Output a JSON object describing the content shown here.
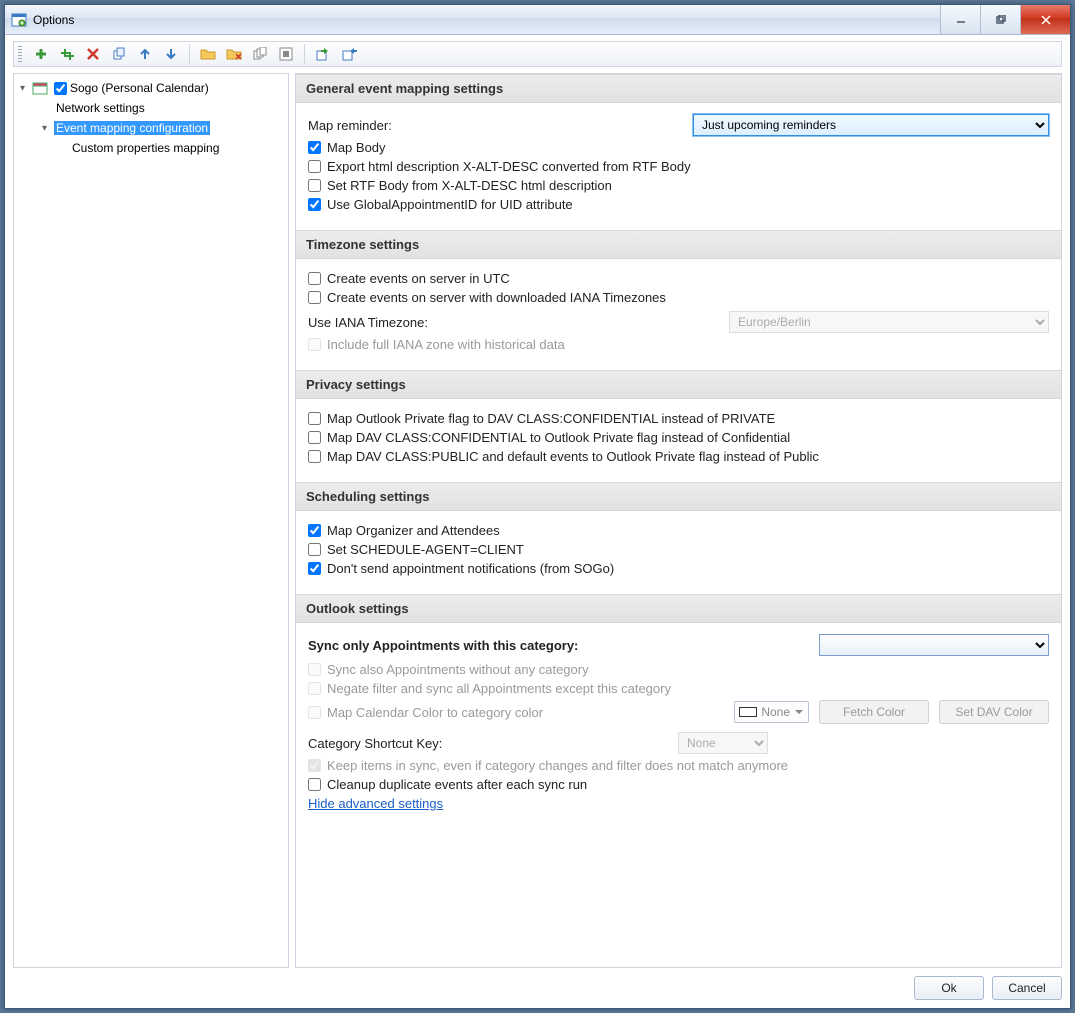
{
  "window": {
    "title": "Options"
  },
  "toolbar_icons": [
    "add",
    "add-multi",
    "delete",
    "copy",
    "up",
    "down",
    "folder",
    "folder-x",
    "copy-all",
    "select-all",
    "export",
    "import"
  ],
  "tree": {
    "root": {
      "label": "Sogo (Personal Calendar)",
      "checked": true
    },
    "children": [
      {
        "label": "Network settings"
      },
      {
        "label": "Event mapping configuration",
        "selected": true,
        "expanded": true
      },
      {
        "label": "Custom properties mapping"
      }
    ]
  },
  "sections": {
    "general": {
      "title": "General event mapping settings",
      "map_reminder_label": "Map reminder:",
      "map_reminder_value": "Just upcoming reminders",
      "chk_map_body": {
        "label": "Map Body",
        "checked": true
      },
      "chk_export_xalt": {
        "label": "Export html description X-ALT-DESC converted from RTF Body",
        "checked": false
      },
      "chk_set_rtf": {
        "label": "Set RTF Body from X-ALT-DESC html description",
        "checked": false
      },
      "chk_use_globalid": {
        "label": "Use GlobalAppointmentID for UID attribute",
        "checked": true
      }
    },
    "timezone": {
      "title": "Timezone settings",
      "chk_utc": {
        "label": "Create events on server in UTC",
        "checked": false
      },
      "chk_iana_dl": {
        "label": "Create events on server with downloaded IANA Timezones",
        "checked": false
      },
      "use_iana_label": "Use IANA Timezone:",
      "use_iana_value": "Europe/Berlin",
      "chk_full_iana": {
        "label": "Include full IANA zone with historical data",
        "checked": false
      }
    },
    "privacy": {
      "title": "Privacy settings",
      "chk_priv_conf": {
        "label": "Map Outlook Private flag to DAV CLASS:CONFIDENTIAL instead of PRIVATE",
        "checked": false
      },
      "chk_conf_priv": {
        "label": "Map DAV CLASS:CONFIDENTIAL to Outlook Private flag instead of Confidential",
        "checked": false
      },
      "chk_pub_priv": {
        "label": "Map DAV CLASS:PUBLIC and default events to Outlook Private flag instead of Public",
        "checked": false
      }
    },
    "scheduling": {
      "title": "Scheduling settings",
      "chk_org": {
        "label": "Map Organizer and Attendees",
        "checked": true
      },
      "chk_sched_client": {
        "label": "Set SCHEDULE-AGENT=CLIENT",
        "checked": false
      },
      "chk_no_notif": {
        "label": "Don't send appointment notifications (from SOGo)",
        "checked": true
      }
    },
    "outlook": {
      "title": "Outlook settings",
      "sync_cat_label": "Sync only Appointments with this category:",
      "sync_cat_value": "",
      "chk_sync_nocat": {
        "label": "Sync also Appointments without any category",
        "checked": false,
        "disabled": true
      },
      "chk_negate": {
        "label": "Negate filter and sync all Appointments except this category",
        "checked": false,
        "disabled": true
      },
      "chk_map_color": {
        "label": "Map Calendar Color to category color",
        "checked": false,
        "disabled": true
      },
      "color_none": "None",
      "btn_fetch": "Fetch Color",
      "btn_setdav": "Set DAV Color",
      "cat_shortcut_label": "Category Shortcut Key:",
      "cat_shortcut_value": "None",
      "chk_keep_sync": {
        "label": "Keep items in sync, even if category changes and filter does not match anymore",
        "checked": true,
        "disabled": true
      },
      "chk_cleanup": {
        "label": "Cleanup duplicate events after each sync run",
        "checked": false
      },
      "hide_link": "Hide advanced settings"
    }
  },
  "footer": {
    "ok": "Ok",
    "cancel": "Cancel"
  }
}
